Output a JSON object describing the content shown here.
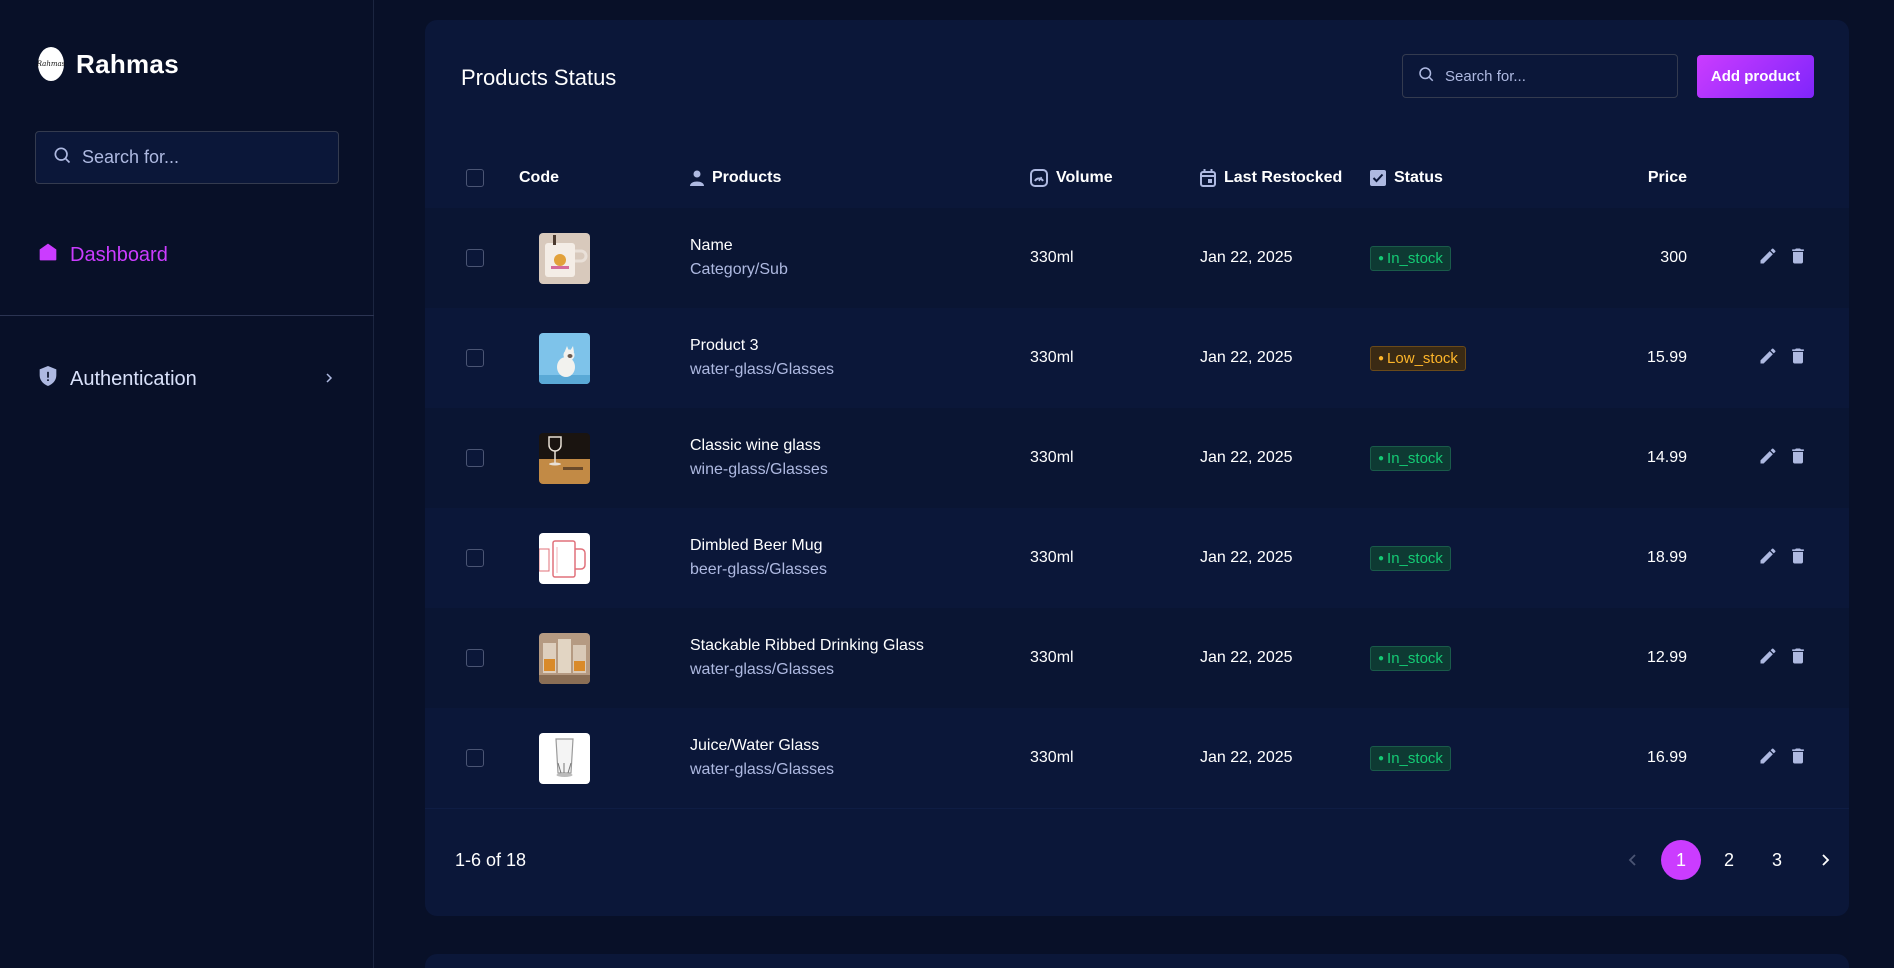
{
  "sidebar": {
    "brand_name": "Rahmas",
    "logo_text": "Rahmas",
    "search_placeholder": "Search for...",
    "nav": {
      "dashboard": "Dashboard",
      "authentication": "Authentication"
    }
  },
  "main": {
    "title": "Products Status",
    "search_placeholder": "Search for...",
    "add_button": "Add product",
    "columns": {
      "code": "Code",
      "products": "Products",
      "volume": "Volume",
      "last_restocked": "Last Restocked",
      "status": "Status",
      "price": "Price"
    },
    "rows": [
      {
        "name": "Name",
        "category": "Category/Sub",
        "volume": "330ml",
        "date": "Jan 22, 2025",
        "status": "In_stock",
        "price": "300"
      },
      {
        "name": "Product 3",
        "category": "water-glass/Glasses",
        "volume": "330ml",
        "date": "Jan 22, 2025",
        "status": "Low_stock",
        "price": "15.99"
      },
      {
        "name": "Classic wine glass",
        "category": "wine-glass/Glasses",
        "volume": "330ml",
        "date": "Jan 22, 2025",
        "status": "In_stock",
        "price": "14.99"
      },
      {
        "name": "Dimbled Beer Mug",
        "category": "beer-glass/Glasses",
        "volume": "330ml",
        "date": "Jan 22, 2025",
        "status": "In_stock",
        "price": "18.99"
      },
      {
        "name": "Stackable Ribbed Drinking Glass",
        "category": "water-glass/Glasses",
        "volume": "330ml",
        "date": "Jan 22, 2025",
        "status": "In_stock",
        "price": "12.99"
      },
      {
        "name": "Juice/Water Glass",
        "category": "water-glass/Glasses",
        "volume": "330ml",
        "date": "Jan 22, 2025",
        "status": "In_stock",
        "price": "16.99"
      }
    ],
    "footer_count": "1-6 of 18",
    "pagination": {
      "pages": [
        "1",
        "2",
        "3"
      ],
      "active": "1"
    }
  },
  "colors": {
    "accent": "#cb3cff",
    "background": "#081028",
    "card": "#0b1739",
    "in_stock": "#14ca74",
    "low_stock": "#fdb52a"
  }
}
